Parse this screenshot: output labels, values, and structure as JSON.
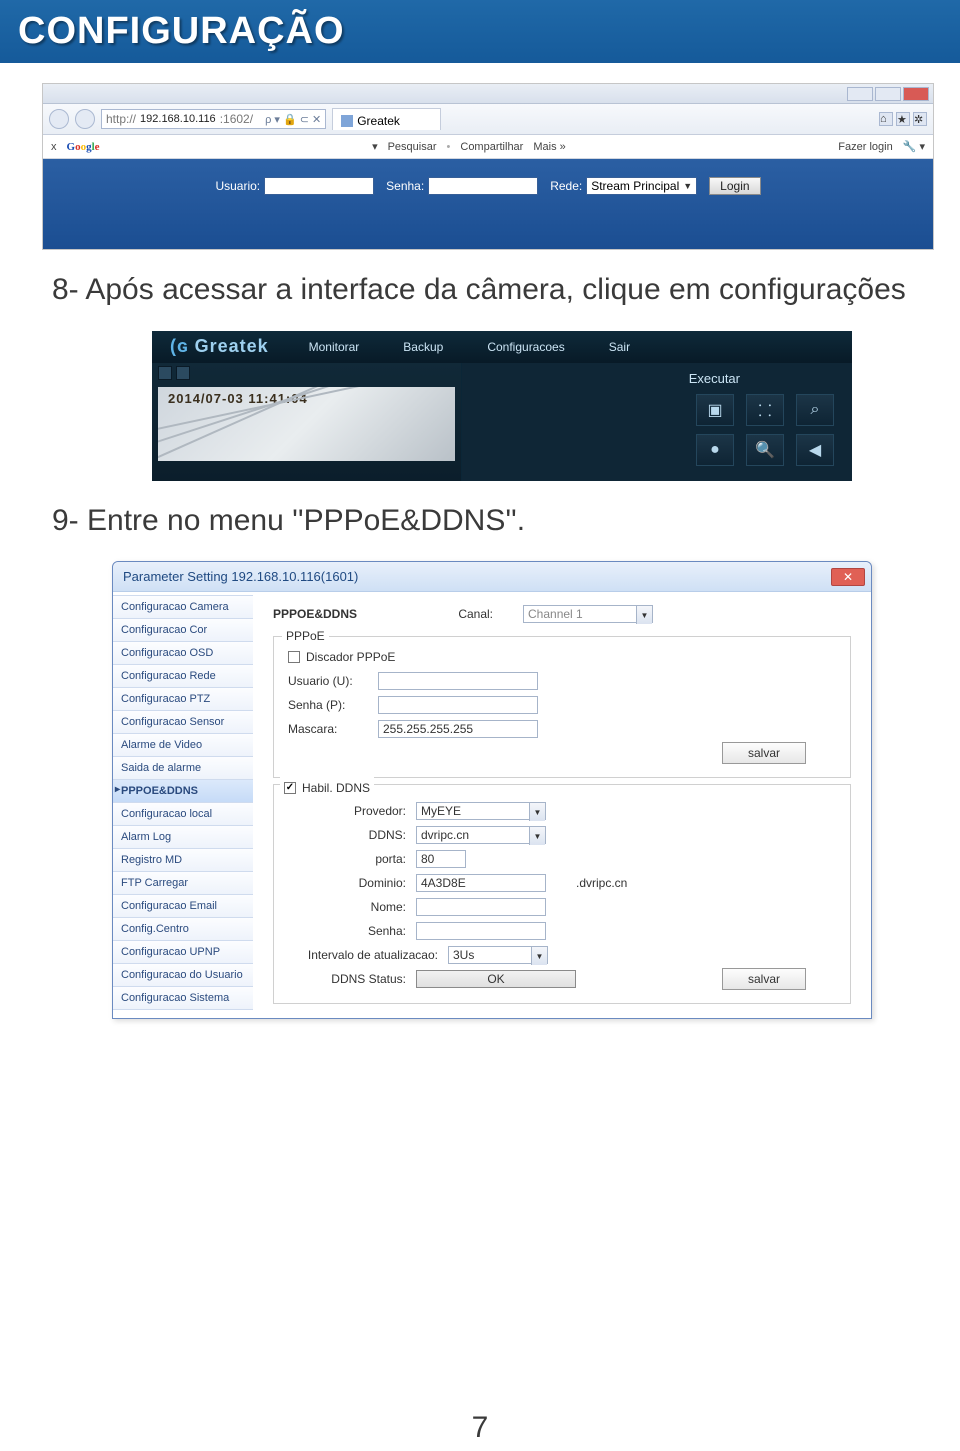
{
  "header": {
    "title": "CONFIGURAÇÃO"
  },
  "text1": "8- Após acessar a interface da câmera, clique em configurações",
  "text2": "9- Entre no menu ''PPPoE&DDNS''.",
  "page_number": "7",
  "ss1": {
    "url_prefix": "http://",
    "url": "192.168.10.116",
    "url_suffix": ":1602/",
    "search_hint": "🔍",
    "tab_title": "Greatek",
    "google_x": "x",
    "google": "Google",
    "toolbar": {
      "pesquisar": "Pesquisar",
      "compartilhar": "Compartilhar",
      "mais": "Mais »",
      "login": "Fazer login"
    },
    "form": {
      "usuario_label": "Usuario:",
      "senha_label": "Senha:",
      "rede_label": "Rede:",
      "rede_value": "Stream Principal",
      "login_btn": "Login"
    },
    "topright": {
      "home": "⌂",
      "star": "★",
      "gear": "✲"
    }
  },
  "ss2": {
    "brand": "Greatek",
    "menu": {
      "monitorar": "Monitorar",
      "backup": "Backup",
      "config": "Configuracoes",
      "sair": "Sair"
    },
    "timestamp": "2014/07-03 11:41:04",
    "executar": "Executar",
    "icons": {
      "i1": "▣",
      "i2": "⸬",
      "i3": "⌕",
      "i4": "●",
      "i5": "🔍",
      "i6": "◀"
    }
  },
  "ss3": {
    "window_title": "Parameter Setting 192.168.10.116(1601)",
    "side": {
      "items": [
        "Configuracao Camera",
        "Configuracao Cor",
        "Configuracao OSD",
        "Configuracao Rede",
        "Configuracao PTZ",
        "Configuracao Sensor",
        "Alarme de Video",
        "Saida de alarme",
        "PPPOE&DDNS",
        "Configuracao local",
        "Alarm Log",
        "Registro MD",
        "FTP Carregar",
        "Configuracao Email",
        "Config.Centro",
        "Configuracao UPNP",
        "Configuracao do Usuario",
        "Configuracao Sistema"
      ],
      "active_index": 8
    },
    "section_title": "PPPOE&DDNS",
    "canal_label": "Canal:",
    "canal_value": "Channel 1",
    "pppoe": {
      "legend": "PPPoE",
      "discador": "Discador PPPoE",
      "usuario_label": "Usuario (U):",
      "senha_label": "Senha (P):",
      "mascara_label": "Mascara:",
      "mascara_value": "255.255.255.255",
      "salvar": "salvar"
    },
    "ddns": {
      "habil": "Habil. DDNS",
      "provedor_label": "Provedor:",
      "provedor_value": "MyEYE",
      "ddns_label": "DDNS:",
      "ddns_value": "dvripc.cn",
      "porta_label": "porta:",
      "porta_value": "80",
      "dominio_label": "Dominio:",
      "dominio_value": "4A3D8E",
      "dominio_suffix": ".dvripc.cn",
      "nome_label": "Nome:",
      "senha_label": "Senha:",
      "intervalo_label": "Intervalo de atualizacao:",
      "intervalo_value": "3Us",
      "status_label": "DDNS Status:",
      "status_value": "OK",
      "salvar": "salvar"
    }
  }
}
